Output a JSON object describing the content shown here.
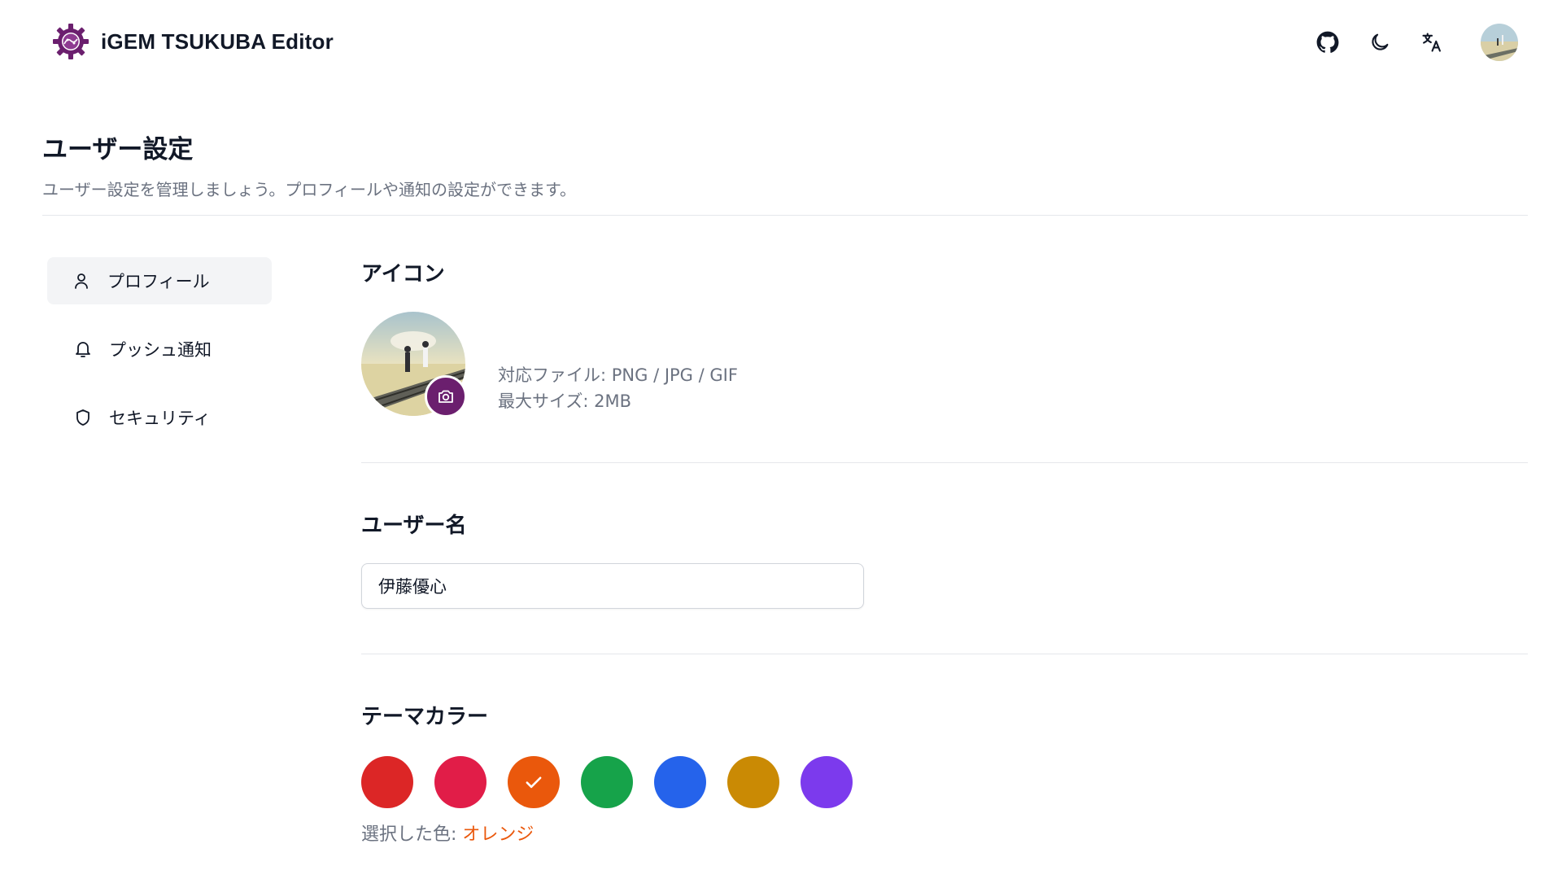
{
  "header": {
    "app_name": "iGEM TSUKUBA Editor",
    "actions": [
      "github-icon",
      "moon-icon",
      "translate-icon",
      "user-avatar"
    ]
  },
  "page": {
    "title": "ユーザー設定",
    "description": "ユーザー設定を管理しましょう。プロフィールや通知の設定ができます。"
  },
  "sidebar": {
    "items": [
      {
        "label": "プロフィール",
        "icon": "user-icon",
        "active": true
      },
      {
        "label": "プッシュ通知",
        "icon": "bell-icon",
        "active": false
      },
      {
        "label": "セキュリティ",
        "icon": "shield-icon",
        "active": false
      }
    ]
  },
  "sections": {
    "icon": {
      "title": "アイコン",
      "supported_files": "対応ファイル: PNG / JPG / GIF",
      "max_size": "最大サイズ: 2MB"
    },
    "username": {
      "title": "ユーザー名",
      "value": "伊藤優心"
    },
    "theme": {
      "title": "テーマカラー",
      "colors": [
        {
          "name": "red",
          "hex": "#dc2626"
        },
        {
          "name": "rose",
          "hex": "#e11d48"
        },
        {
          "name": "orange",
          "hex": "#ea580c",
          "selected": true
        },
        {
          "name": "green",
          "hex": "#16a34a"
        },
        {
          "name": "blue",
          "hex": "#2563eb"
        },
        {
          "name": "amber",
          "hex": "#ca8a04"
        },
        {
          "name": "violet",
          "hex": "#7c3aed"
        }
      ],
      "selected_label": "選択した色: ",
      "selected_value": "オレンジ"
    }
  }
}
